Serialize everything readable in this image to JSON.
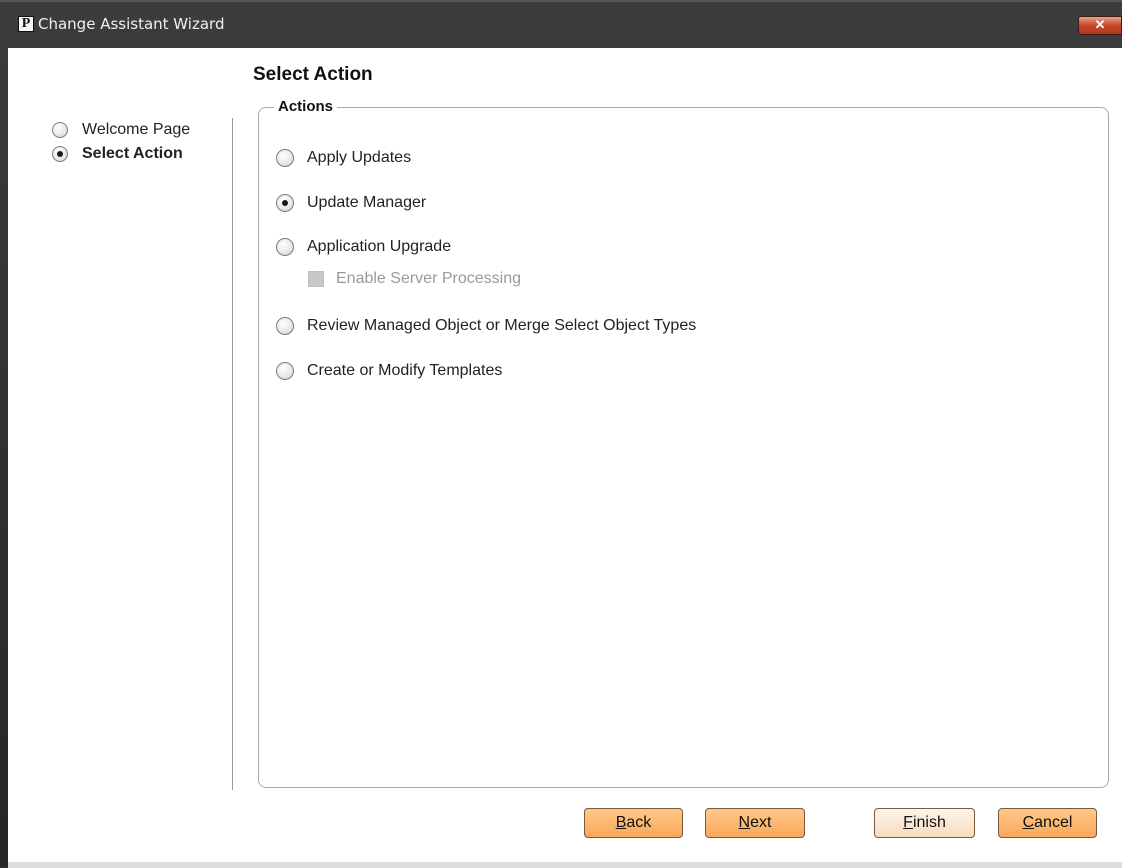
{
  "window": {
    "title": "Change Assistant Wizard",
    "app_icon_letter": "P",
    "close_glyph": "✕"
  },
  "nav": {
    "items": [
      {
        "label": "Welcome Page",
        "selected": false
      },
      {
        "label": "Select Action",
        "selected": true
      }
    ]
  },
  "page": {
    "title": "Select Action"
  },
  "actions": {
    "legend": "Actions",
    "options": [
      {
        "label": "Apply Updates",
        "selected": false
      },
      {
        "label": "Update Manager",
        "selected": true
      },
      {
        "label": "Application Upgrade",
        "selected": false
      },
      {
        "label": "Review Managed Object or Merge Select Object Types",
        "selected": false
      },
      {
        "label": "Create or Modify Templates",
        "selected": false
      }
    ],
    "sub_option": {
      "label": "Enable Server Processing",
      "checked": false,
      "enabled": false
    }
  },
  "buttons": {
    "back": {
      "mnemonic": "B",
      "rest": "ack"
    },
    "next": {
      "mnemonic": "N",
      "rest": "ext"
    },
    "finish": {
      "mnemonic": "F",
      "rest": "inish"
    },
    "cancel": {
      "mnemonic": "C",
      "rest": "ancel"
    }
  },
  "colors": {
    "button_accent": "#f7a85b",
    "title_bar": "#3c3c3c"
  }
}
